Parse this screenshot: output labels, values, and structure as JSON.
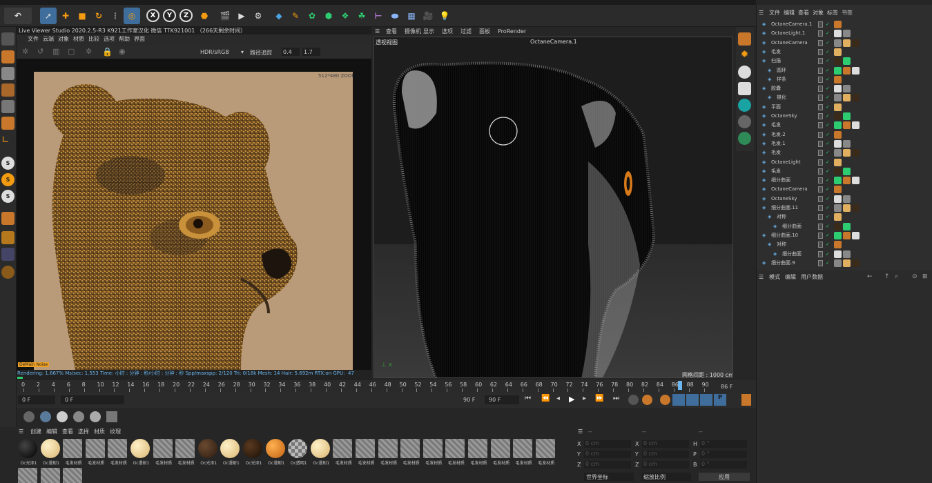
{
  "live_viewer": {
    "title": "Live Viewer Studio 2020.2.5-R3  K921工作室汉化 微信 TTK921001 （266天剩余时间）",
    "menu": [
      "文件",
      "云端",
      "对象",
      "材质",
      "比较",
      "选项",
      "帮助",
      "界面"
    ],
    "color_mode": "HDR/sRGB",
    "tracking": "路径追踪",
    "value_a": "0.4",
    "value_b": "1.7",
    "resolution": "512*480 ZOOM:",
    "denoise_tag": "DeMain Noise",
    "status": "Rendering: 1.667%  Ms/sec: 1.553   Time: 小时 : 分钟 : 秒/小时 : 分钟 : 秒  Spp/maxspp: 2/120   Tri: 0/18k   Mesh: 14   Hair: 5.692m  RTX:on     GPU:",
    "gpu_value": "47"
  },
  "viewport": {
    "menu": [
      "查看",
      "摄像机",
      "显示",
      "选项",
      "过滤",
      "面板",
      "ProRender"
    ],
    "label": "透视视图",
    "camera": "OctaneCamera.1",
    "grid_info": "网格间距 : 1000 cm"
  },
  "object_panel": {
    "menu": [
      "文件",
      "编辑",
      "查看",
      "对象",
      "标签",
      "书签"
    ],
    "rows": [
      {
        "name": "OctaneCamera.1",
        "indent": 0
      },
      {
        "name": "OctaneLight.1",
        "indent": 0
      },
      {
        "name": "OctaneCamera",
        "indent": 0
      },
      {
        "name": "毛发",
        "indent": 0
      },
      {
        "name": "扫描",
        "indent": 0
      },
      {
        "name": "圆环",
        "indent": 1
      },
      {
        "name": "样条",
        "indent": 1
      },
      {
        "name": "胶囊",
        "indent": 0
      },
      {
        "name": "锥化",
        "indent": 1
      },
      {
        "name": "平面",
        "indent": 0
      },
      {
        "name": "OctaneSky",
        "indent": 0
      },
      {
        "name": "毛发",
        "indent": 0
      },
      {
        "name": "毛发.2",
        "indent": 0
      },
      {
        "name": "毛发.1",
        "indent": 0
      },
      {
        "name": "毛发",
        "indent": 0
      },
      {
        "name": "OctaneLight",
        "indent": 0
      },
      {
        "name": "毛发",
        "indent": 0
      },
      {
        "name": "细分曲面",
        "indent": 0
      },
      {
        "name": "OctaneCamera",
        "indent": 0
      },
      {
        "name": "OctaneSky",
        "indent": 0
      },
      {
        "name": "细分曲面.11",
        "indent": 0
      },
      {
        "name": "对称",
        "indent": 1
      },
      {
        "name": "细分曲面",
        "indent": 2
      },
      {
        "name": "细分曲面.10",
        "indent": 0
      },
      {
        "name": "对称",
        "indent": 1
      },
      {
        "name": "细分曲面",
        "indent": 2
      },
      {
        "name": "细分曲面.9",
        "indent": 0
      }
    ]
  },
  "attr_panel": {
    "menu": [
      "模式",
      "编辑",
      "用户数据"
    ]
  },
  "timeline": {
    "ticks": [
      "0",
      "2",
      "4",
      "6",
      "8",
      "10",
      "12",
      "14",
      "16",
      "18",
      "20",
      "22",
      "24",
      "26",
      "28",
      "30",
      "32",
      "34",
      "36",
      "38",
      "40",
      "42",
      "44",
      "46",
      "48",
      "50",
      "52",
      "54",
      "56",
      "58",
      "60",
      "62",
      "64",
      "66",
      "68",
      "70",
      "72",
      "74",
      "76",
      "78",
      "80",
      "82",
      "84",
      "86",
      "88",
      "90"
    ],
    "current_frame": "86 F",
    "start": "0 F",
    "start2": "0 F",
    "end": "90 F",
    "end2": "90 F"
  },
  "materials": {
    "menu": [
      "创建",
      "编辑",
      "查看",
      "选择",
      "材质",
      "纹理"
    ],
    "items": [
      {
        "label": "Oc光泽1",
        "kind": "black"
      },
      {
        "label": "Oc漫射1",
        "kind": "cream"
      },
      {
        "label": "毛发材质",
        "kind": "hatch"
      },
      {
        "label": "毛发材质",
        "kind": "hatch"
      },
      {
        "label": "毛发材质",
        "kind": "hatch"
      },
      {
        "label": "Oc漫射1",
        "kind": "cream"
      },
      {
        "label": "毛发材质",
        "kind": "hatch"
      },
      {
        "label": "毛发材质",
        "kind": "hatch"
      },
      {
        "label": "Oc光泽1",
        "kind": "brown"
      },
      {
        "label": "Oc漫射1",
        "kind": "cream"
      },
      {
        "label": "Oc光泽1",
        "kind": "darkbrown"
      },
      {
        "label": "Oc漫射1",
        "kind": "orange"
      },
      {
        "label": "Oc透明1",
        "kind": "checker"
      },
      {
        "label": "Oc漫射1",
        "kind": "cream"
      },
      {
        "label": "毛发材质",
        "kind": "hatch"
      },
      {
        "label": "毛发材质",
        "kind": "hatch"
      },
      {
        "label": "毛发材质",
        "kind": "hatch"
      },
      {
        "label": "毛发材质",
        "kind": "hatch"
      },
      {
        "label": "毛发材质",
        "kind": "hatch"
      },
      {
        "label": "毛发材质",
        "kind": "hatch"
      },
      {
        "label": "毛发材质",
        "kind": "hatch"
      },
      {
        "label": "毛发材质",
        "kind": "hatch"
      },
      {
        "label": "毛发材质",
        "kind": "hatch"
      },
      {
        "label": "毛发材质",
        "kind": "hatch"
      },
      {
        "label": "",
        "kind": "hatch"
      },
      {
        "label": "",
        "kind": "hatch"
      },
      {
        "label": "",
        "kind": "hatch"
      }
    ]
  },
  "coords": {
    "header": [
      "--",
      "--",
      "--"
    ],
    "rows": [
      {
        "a": "X",
        "av": "0 cm",
        "b": "X",
        "bv": "0 cm",
        "c": "H",
        "cv": "0 °"
      },
      {
        "a": "Y",
        "av": "0 cm",
        "b": "Y",
        "bv": "0 cm",
        "c": "P",
        "cv": "0 °"
      },
      {
        "a": "Z",
        "av": "0 cm",
        "b": "Z",
        "bv": "0 cm",
        "c": "B",
        "cv": "0 °"
      }
    ],
    "mode_a": "世界坐标",
    "mode_b": "缩放比例",
    "apply": "应用"
  },
  "colors": {
    "accent": "#3f6e9c",
    "orange": "#d87a1a",
    "panel": "#2b2b2b"
  }
}
